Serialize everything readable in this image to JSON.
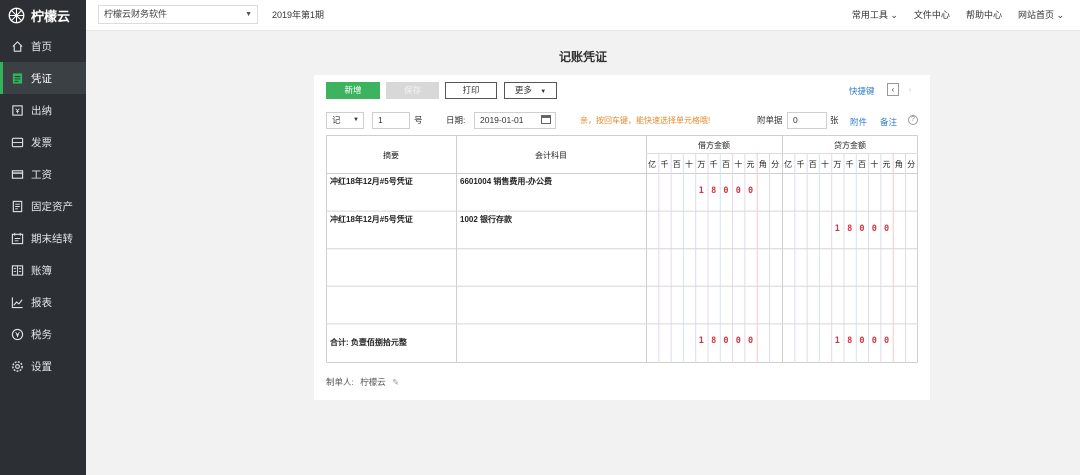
{
  "app": {
    "name": "柠檬云"
  },
  "sidebar": {
    "items": [
      {
        "label": "首页",
        "icon": "home-icon"
      },
      {
        "label": "凭证",
        "icon": "voucher-icon",
        "active": true
      },
      {
        "label": "出纳",
        "icon": "cashier-icon"
      },
      {
        "label": "发票",
        "icon": "invoice-icon"
      },
      {
        "label": "工资",
        "icon": "salary-icon"
      },
      {
        "label": "固定资产",
        "icon": "assets-icon"
      },
      {
        "label": "期末结转",
        "icon": "closing-icon"
      },
      {
        "label": "账簿",
        "icon": "ledger-icon"
      },
      {
        "label": "报表",
        "icon": "report-icon"
      },
      {
        "label": "税务",
        "icon": "tax-icon"
      },
      {
        "label": "设置",
        "icon": "settings-icon"
      }
    ]
  },
  "topbar": {
    "company": "柠檬云财务软件",
    "period": "2019年第1期",
    "links": [
      "常用工具 ⌄",
      "文件中心",
      "帮助中心",
      "网站首页 ⌄"
    ]
  },
  "page": {
    "title": "记账凭证"
  },
  "toolbar": {
    "new_label": "新增",
    "save_label": "保存",
    "print_label": "打印",
    "more_label": "更多",
    "shortcut_label": "快捷键"
  },
  "form": {
    "voucher_word": "记",
    "voucher_no": "1",
    "no_suffix": "号",
    "date_label": "日期:",
    "date_value": "2019-01-01",
    "tip": "亲，按回车键，能快速选择单元格哦!",
    "attach_label": "附单据",
    "attach_count": "0",
    "attach_unit": "张",
    "attachment_link": "附件",
    "remark_link": "备注",
    "help": "?"
  },
  "table": {
    "col_summary": "摘要",
    "col_account": "会计科目",
    "col_debit": "借方金额",
    "col_credit": "贷方金额",
    "digit_units": [
      "亿",
      "千",
      "百",
      "十",
      "万",
      "千",
      "百",
      "十",
      "元",
      "角",
      "分"
    ],
    "rows": [
      {
        "summary": "冲红18年12月#5号凭证",
        "account": "6601004 销售费用-办公费",
        "debit": "18000",
        "credit": ""
      },
      {
        "summary": "冲红18年12月#5号凭证",
        "account": "1002 银行存款",
        "debit": "",
        "credit": "18000"
      },
      {
        "summary": "",
        "account": "",
        "debit": "",
        "credit": ""
      },
      {
        "summary": "",
        "account": "",
        "debit": "",
        "credit": ""
      }
    ],
    "total_label": "合计: 负壹佰捌拾元整",
    "total_debit": "18000",
    "total_credit": "18000"
  },
  "footer": {
    "maker_label": "制单人:",
    "maker_name": "柠檬云"
  },
  "colors": {
    "accent": "#3cb45f",
    "sidebar": "#2c3034",
    "amount": "#d9333f",
    "tip": "#e48a2d",
    "link": "#2f7dd0"
  }
}
